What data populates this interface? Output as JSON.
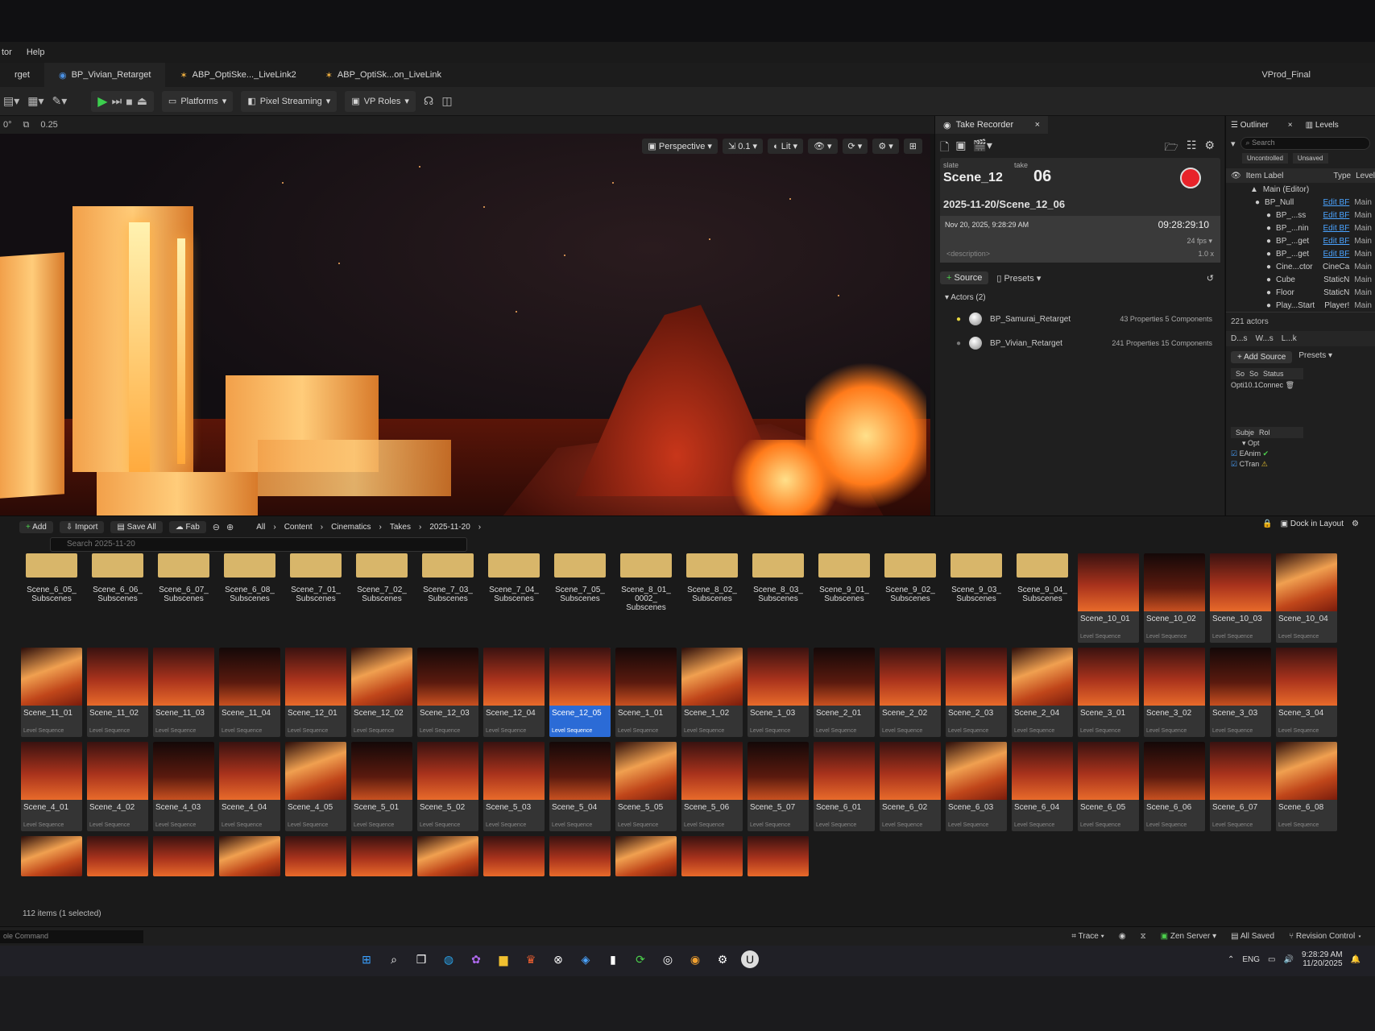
{
  "menu": {
    "items": [
      "tor",
      "Help"
    ]
  },
  "tabs": [
    {
      "label": "rget"
    },
    {
      "label": "BP_Vivian_Retarget"
    },
    {
      "label": "ABP_OptiSke..._LiveLink2"
    },
    {
      "label": "ABP_OptiSk...on_LiveLink"
    }
  ],
  "project": "VProd_Final",
  "toolbar": {
    "platforms": "Platforms",
    "pixel_streaming": "Pixel Streaming",
    "vp_roles": "VP Roles"
  },
  "subbar": {
    "angle": "0°",
    "scale": "0.25"
  },
  "viewport": {
    "perspective": "Perspective",
    "speed": "0.1",
    "lit": "Lit"
  },
  "take_recorder": {
    "title": "Take Recorder",
    "slate_label": "slate",
    "take_label": "take",
    "slate": "Scene_12",
    "take": "06",
    "path": "2025-11-20/Scene_12_06",
    "datetime": "Nov 20, 2025, 9:28:29 AM",
    "timecode": "09:28:29:10",
    "fps": "24 fps",
    "description": "<description>",
    "rate": "1.0 x",
    "source_btn": "Source",
    "presets": "Presets",
    "actors_header": "Actors (2)",
    "actors": [
      {
        "name": "BP_Samurai_Retarget",
        "props": "43 Properties 5 Components"
      },
      {
        "name": "BP_Vivian_Retarget",
        "props": "241 Properties 15 Components"
      }
    ]
  },
  "outliner": {
    "title": "Outliner",
    "levels": "Levels",
    "search": "Search",
    "uncontrolled": "Uncontrolled",
    "unsaved": "Unsaved",
    "col_label": "Item Label",
    "col_type": "Type",
    "col_level": "Level",
    "rows": [
      {
        "label": "Main (Editor)",
        "type": "",
        "level": ""
      },
      {
        "label": "BP_Null",
        "type": "Edit BF",
        "level": "Main"
      },
      {
        "label": "BP_...ss",
        "type": "Edit BF",
        "level": "Main"
      },
      {
        "label": "BP_...nin",
        "type": "Edit BF",
        "level": "Main"
      },
      {
        "label": "BP_...get",
        "type": "Edit BF",
        "level": "Main"
      },
      {
        "label": "BP_...get",
        "type": "Edit BF",
        "level": "Main"
      },
      {
        "label": "Cine...ctor",
        "type": "CineCa",
        "level": "Main"
      },
      {
        "label": "Cube",
        "type": "StaticN",
        "level": "Main"
      },
      {
        "label": "Floor",
        "type": "StaticN",
        "level": "Main"
      },
      {
        "label": "Play...Start",
        "type": "Player!",
        "level": "Main"
      }
    ],
    "actors_count": "221 actors",
    "livelink_tabs": [
      "D...s",
      "W...s",
      "L...k"
    ],
    "add_source": "Add Source",
    "presets": "Presets",
    "ll_cols": [
      "So",
      "So",
      "Status"
    ],
    "ll_row": "Opti10.1Connec",
    "subj_cols": [
      "Subje",
      "Rol"
    ],
    "subjects": [
      "Opt",
      "EAnim",
      "CTran"
    ]
  },
  "content_browser": {
    "add": "Add",
    "import": "Import",
    "save_all": "Save All",
    "fab": "Fab",
    "crumbs": [
      "All",
      "Content",
      "Cinematics",
      "Takes",
      "2025-11-20"
    ],
    "dock": "Dock in Layout",
    "search_placeholder": "Search 2025-11-20",
    "count": "112 items (1 selected)",
    "folders": [
      "Scene_6_05_ Subscenes",
      "Scene_6_06_ Subscenes",
      "Scene_6_07_ Subscenes",
      "Scene_6_08_ Subscenes",
      "Scene_7_01_ Subscenes",
      "Scene_7_02_ Subscenes",
      "Scene_7_03_ Subscenes",
      "Scene_7_04_ Subscenes",
      "Scene_7_05_ Subscenes",
      "Scene_8_01_ 0002_ Subscenes",
      "Scene_8_02_ Subscenes",
      "Scene_8_03_ Subscenes",
      "Scene_9_01_ Subscenes",
      "Scene_9_02_ Subscenes",
      "Scene_9_03_ Subscenes",
      "Scene_9_04_ Subscenes"
    ],
    "row1_seq": [
      "Scene_10_01",
      "Scene_10_02",
      "Scene_10_03",
      "Scene_10_04"
    ],
    "row2": [
      "Scene_11_01",
      "Scene_11_02",
      "Scene_11_03",
      "Scene_11_04",
      "Scene_12_01",
      "Scene_12_02",
      "Scene_12_03",
      "Scene_12_04",
      "Scene_12_05",
      "Scene_1_01",
      "Scene_1_02",
      "Scene_1_03",
      "Scene_2_01",
      "Scene_2_02",
      "Scene_2_03",
      "Scene_2_04",
      "Scene_3_01",
      "Scene_3_02",
      "Scene_3_03",
      "Scene_3_04"
    ],
    "row3": [
      "Scene_4_01",
      "Scene_4_02",
      "Scene_4_03",
      "Scene_4_04",
      "Scene_4_05",
      "Scene_5_01",
      "Scene_5_02",
      "Scene_5_03",
      "Scene_5_04",
      "Scene_5_05",
      "Scene_5_06",
      "Scene_5_07",
      "Scene_6_01",
      "Scene_6_02",
      "Scene_6_03",
      "Scene_6_04",
      "Scene_6_05",
      "Scene_6_06",
      "Scene_6_07",
      "Scene_6_08"
    ],
    "selected": "Scene_12_05",
    "type_label": "Level Sequence"
  },
  "statusbar": {
    "console": "ole Command",
    "trace": "Trace",
    "zen": "Zen Server",
    "saved": "All Saved",
    "revision": "Revision Control"
  },
  "taskbar": {
    "lang": "ENG",
    "time": "9:28:29 AM",
    "date": "11/20/2025"
  }
}
